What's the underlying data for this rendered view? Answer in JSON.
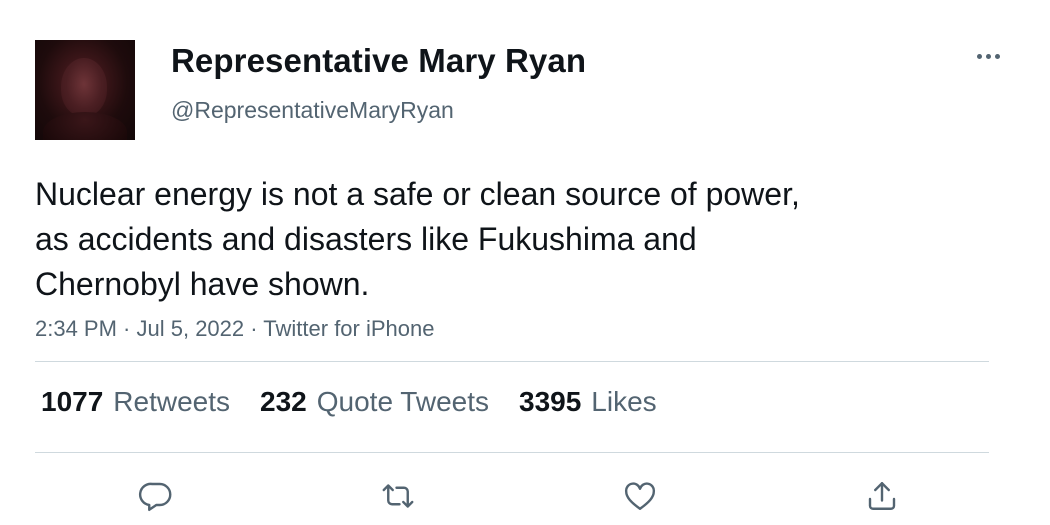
{
  "user": {
    "display_name": "Representative Mary Ryan",
    "handle": "@RepresentativeMaryRyan"
  },
  "tweet": {
    "text": "Nuclear energy is not a safe or clean source of power,\nas accidents and disasters like Fukushima and\nChernobyl have shown.",
    "time": "2:34 PM",
    "date": "Jul 5, 2022",
    "source": "Twitter for iPhone",
    "separator": " · "
  },
  "stats": {
    "retweets": {
      "count": "1077",
      "label": "Retweets"
    },
    "quote_tweets": {
      "count": "232",
      "label": "Quote Tweets"
    },
    "likes": {
      "count": "3395",
      "label": "Likes"
    }
  },
  "actions": {
    "icons": [
      "reply-icon",
      "retweet-icon",
      "like-icon",
      "share-icon"
    ]
  },
  "colors": {
    "text_primary": "#0f1419",
    "text_secondary": "#536471",
    "divider": "#cfd9de",
    "background": "#ffffff"
  }
}
